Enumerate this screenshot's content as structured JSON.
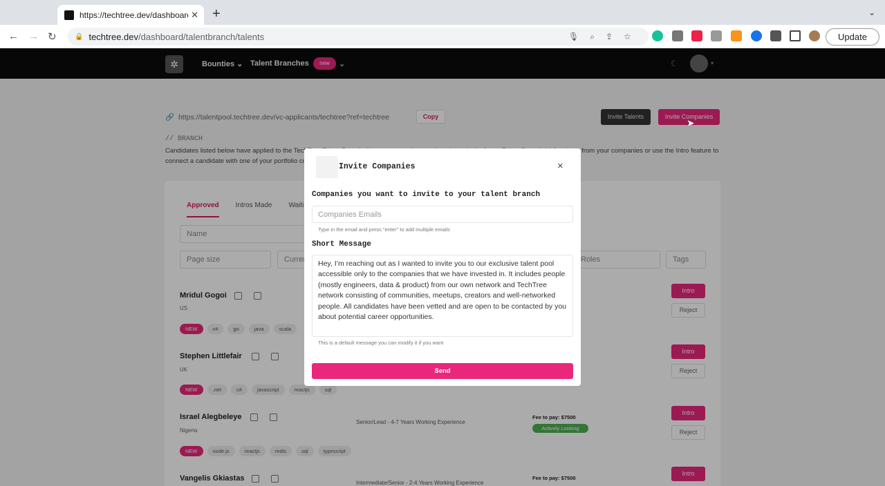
{
  "browser": {
    "tab_title": "https://techtree.dev/dashboard/talentbranch/talents",
    "url_host": "techtree.dev",
    "url_path": "/dashboard/talentbranch/talents",
    "update_label": "Update"
  },
  "navbar": {
    "bounties": "Bounties ⌄",
    "talent_branches": "Talent Branches",
    "new_badge": "new",
    "caret": "⌄"
  },
  "page": {
    "ref_link": "https://talentpool.techtree.dev/vc-applicants/techtree?ref=techtree",
    "copy_label": "Copy",
    "invite_talents": "Invite Talents",
    "invite_companies": "Invite Companies",
    "branch_label": "// BRANCH",
    "description": "Candidates listed below have applied to the TechTree Talent Branch. You can move them to the rejected tab of your Talent Branch, hiding them from your companies or use the Intro feature to connect a candidate with one of your portfolio companies.",
    "tabs": [
      "Approved",
      "Intros Made",
      "Waiting"
    ],
    "name_placeholder": "Name",
    "page_size": "Page size",
    "currency": "Currency",
    "roles": "Roles",
    "tags": "Tags",
    "intro_label": "Intro",
    "reject_label": "Reject"
  },
  "talents": [
    {
      "name": "Mridul Gogoi",
      "country": "US",
      "tags": [
        "NEW",
        "c#",
        "go",
        "java",
        "scala"
      ],
      "experience": "",
      "fee": "",
      "status": ""
    },
    {
      "name": "Stephen Littlefair",
      "country": "UK",
      "tags": [
        "NEW",
        ".net",
        "c#",
        "javascript",
        "reactjs",
        "sql"
      ],
      "experience": "",
      "fee": "",
      "status": ""
    },
    {
      "name": "Israel Alegbeleye",
      "country": "Nigeria",
      "tags": [
        "NEW",
        "node.js",
        "reactjs",
        "redis",
        "sql",
        "typescript"
      ],
      "experience": "Senior/Lead - 4-7 Years Working Experience",
      "fee": "Fee to pay: $7500",
      "status": "Actively Looking"
    },
    {
      "name": "Vangelis Gkiastas",
      "country": "",
      "tags": [],
      "experience": "Intermediate/Senior - 2-4 Years Working Experience",
      "fee": "Fee to pay: $7500",
      "status": ""
    }
  ],
  "modal": {
    "title": "Invite Companies",
    "label_companies": "Companies you want to invite to your talent branch",
    "emails_placeholder": "Companies Emails",
    "emails_hint": "Type in the email and press \"enter\" to add multiple emails",
    "label_message": "Short Message",
    "message": "Hey, I’m reaching out as I wanted to invite you to our exclusive talent pool accessible only to the companies that we have invested in. It includes people (mostly engineers, data & product) from our own network and TechTree network consisting of communities, meetups, creators and well-networked people. All candidates have been vetted and are open to be contacted by you about potential career opportunities.",
    "message_hint": "This is a default message you can modify it if you want",
    "send_label": "Send",
    "close_icon": "×"
  },
  "colors": {
    "accent": "#e9287b",
    "navbar": "#0b0b0b",
    "success": "#4caf50"
  }
}
